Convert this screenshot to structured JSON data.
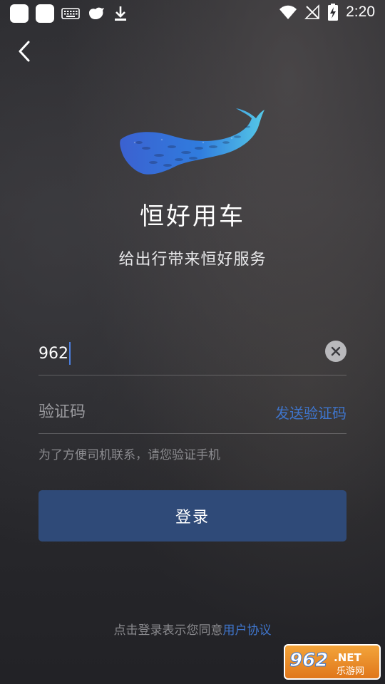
{
  "status_bar": {
    "time": "2:20",
    "icons": [
      "app-square-icon",
      "app-square-icon",
      "keyboard-icon",
      "bird-icon",
      "download-icon",
      "wifi-icon",
      "no-signal-icon",
      "battery-charging-icon"
    ]
  },
  "nav": {
    "back_icon": "back-chevron-icon"
  },
  "app": {
    "title": "恒好用车",
    "slogan": "给出行带来恒好服务",
    "logo_icon": "whale-fish-logo"
  },
  "form": {
    "phone_value": "962",
    "clear_icon": "clear-circle-icon",
    "code_placeholder": "验证码",
    "send_code_label": "发送验证码",
    "hint": "为了方便司机联系，请您验证手机",
    "login_label": "登录"
  },
  "agreement": {
    "prefix": "点击登录表示您同意",
    "link": "用户协议"
  },
  "watermark": {
    "number": "962",
    "suffix": ".NET",
    "subtitle": "乐游网"
  },
  "colors": {
    "accent_link": "#3f75cc",
    "login_button": "#2f4a78",
    "caret": "#4b7fe0"
  }
}
